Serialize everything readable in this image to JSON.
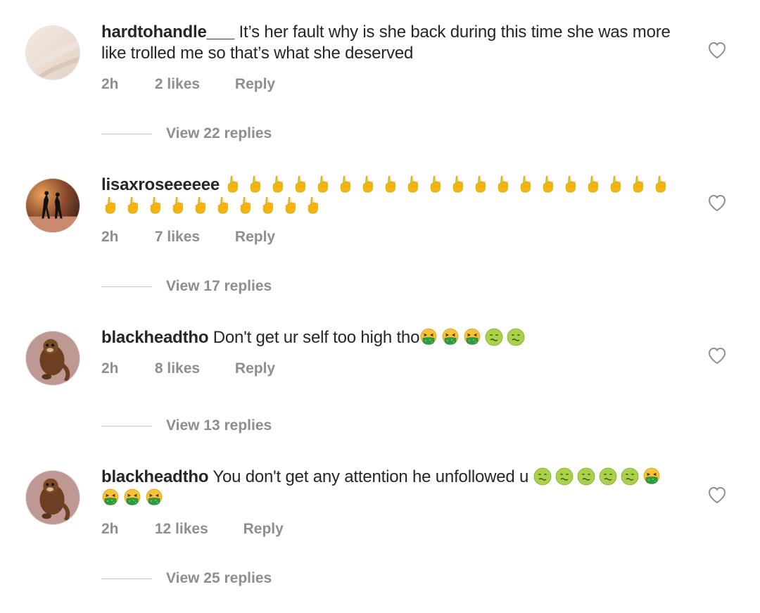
{
  "comments": [
    {
      "username": "hardtohandle___",
      "text": "It’s her fault why is she back during this time she was more like  trolled me so that’s what she deserved",
      "time": "2h",
      "likes": "2 likes",
      "reply_label": "Reply",
      "view_replies": "View 22 replies"
    },
    {
      "username": "lisaxroseeeeee",
      "text": "",
      "emoji": "middle-finger-emoji",
      "emoji_count": 30,
      "time": "2h",
      "likes": "7 likes",
      "reply_label": "Reply",
      "view_replies": "View 17 replies"
    },
    {
      "username": "blackheadtho",
      "text": "Don't get ur self too high tho",
      "emoji_sequence": [
        "vomiting-face-emoji",
        "vomiting-face-emoji",
        "vomiting-face-emoji",
        "nauseated-face-emoji",
        "nauseated-face-emoji"
      ],
      "time": "2h",
      "likes": "8 likes",
      "reply_label": "Reply",
      "view_replies": "View 13 replies"
    },
    {
      "username": "blackheadtho",
      "text": "You don't get any attention he unfollowed u",
      "emoji_sequence": [
        "nauseated-face-emoji",
        "nauseated-face-emoji",
        "nauseated-face-emoji",
        "nauseated-face-emoji",
        "nauseated-face-emoji",
        "vomiting-face-emoji",
        "vomiting-face-emoji",
        "vomiting-face-emoji",
        "vomiting-face-emoji"
      ],
      "time": "2h",
      "likes": "12 likes",
      "reply_label": "Reply",
      "view_replies": "View 25 replies"
    }
  ],
  "icons": {
    "like": "heart-outline-icon"
  },
  "colors": {
    "text": "#262626",
    "meta": "#8e8e8e",
    "emoji_yellow": "#f5b50f",
    "nausea_green": "#9fcf3b",
    "vomit_green": "#2e9b3c"
  }
}
